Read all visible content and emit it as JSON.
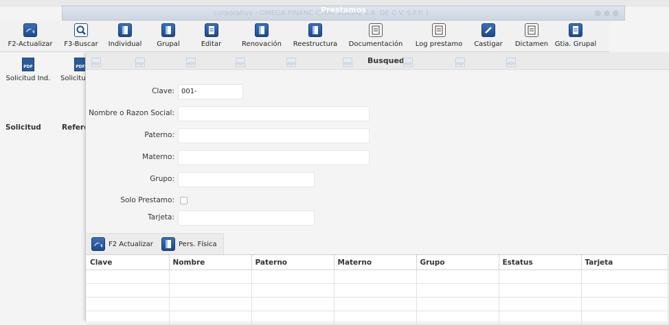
{
  "window": {
    "title": "Prestamos",
    "ghost_title": "corporativo - OMEGA FINANC                    CTOR SOCIAL S.A. DE C.V. S.F.P. )"
  },
  "toolbar": [
    {
      "label": "F2-Actualizar",
      "icon": "refresh-icon"
    },
    {
      "label": "F3-Buscar",
      "icon": "search-icon"
    },
    {
      "label": "Individual",
      "icon": "person-icon"
    },
    {
      "label": "Grupal",
      "icon": "group-icon"
    },
    {
      "label": "Editar",
      "icon": "edit-icon"
    },
    {
      "label": "Renovación",
      "icon": "renew-icon"
    },
    {
      "label": "Reestructura",
      "icon": "restructure-icon"
    },
    {
      "label": "Documentación",
      "icon": "document-icon"
    },
    {
      "label": "Log prestamo",
      "icon": "log-icon"
    },
    {
      "label": "Castigar",
      "icon": "penalize-icon"
    },
    {
      "label": "Dictamen",
      "icon": "report-icon"
    },
    {
      "label": "Gtia. Grupal",
      "icon": "guarantee-icon"
    }
  ],
  "toolbar2": [
    {
      "label": "Solicitud Ind.",
      "icon": "pdf-icon"
    },
    {
      "label": "Solicitu",
      "icon": "pdf-icon"
    }
  ],
  "background_columns": [
    "Solicitud",
    "Referen"
  ],
  "dialog": {
    "title": "Busqueda",
    "header_icon": "pdf-icon",
    "form": {
      "clave_label": "Clave:",
      "clave_value": "001-",
      "nombre_label": "Nombre o Razon Social:",
      "paterno_label": "Paterno:",
      "materno_label": "Materno:",
      "grupo_label": "Grupo:",
      "solo_prestamo_label": "Solo Prestamo:",
      "tarjeta_label": "Tarjeta:"
    },
    "tools": {
      "actualizar_label": "F2 Actualizar",
      "pers_fisica_label": "Pers. Física"
    },
    "grid_columns": [
      "Clave",
      "Nombre",
      "Paterno",
      "Materno",
      "Grupo",
      "Estatus",
      "Tarjeta"
    ]
  },
  "colors": {
    "accent": "#2b5a9c",
    "title_bar": "#cdd6e3"
  }
}
